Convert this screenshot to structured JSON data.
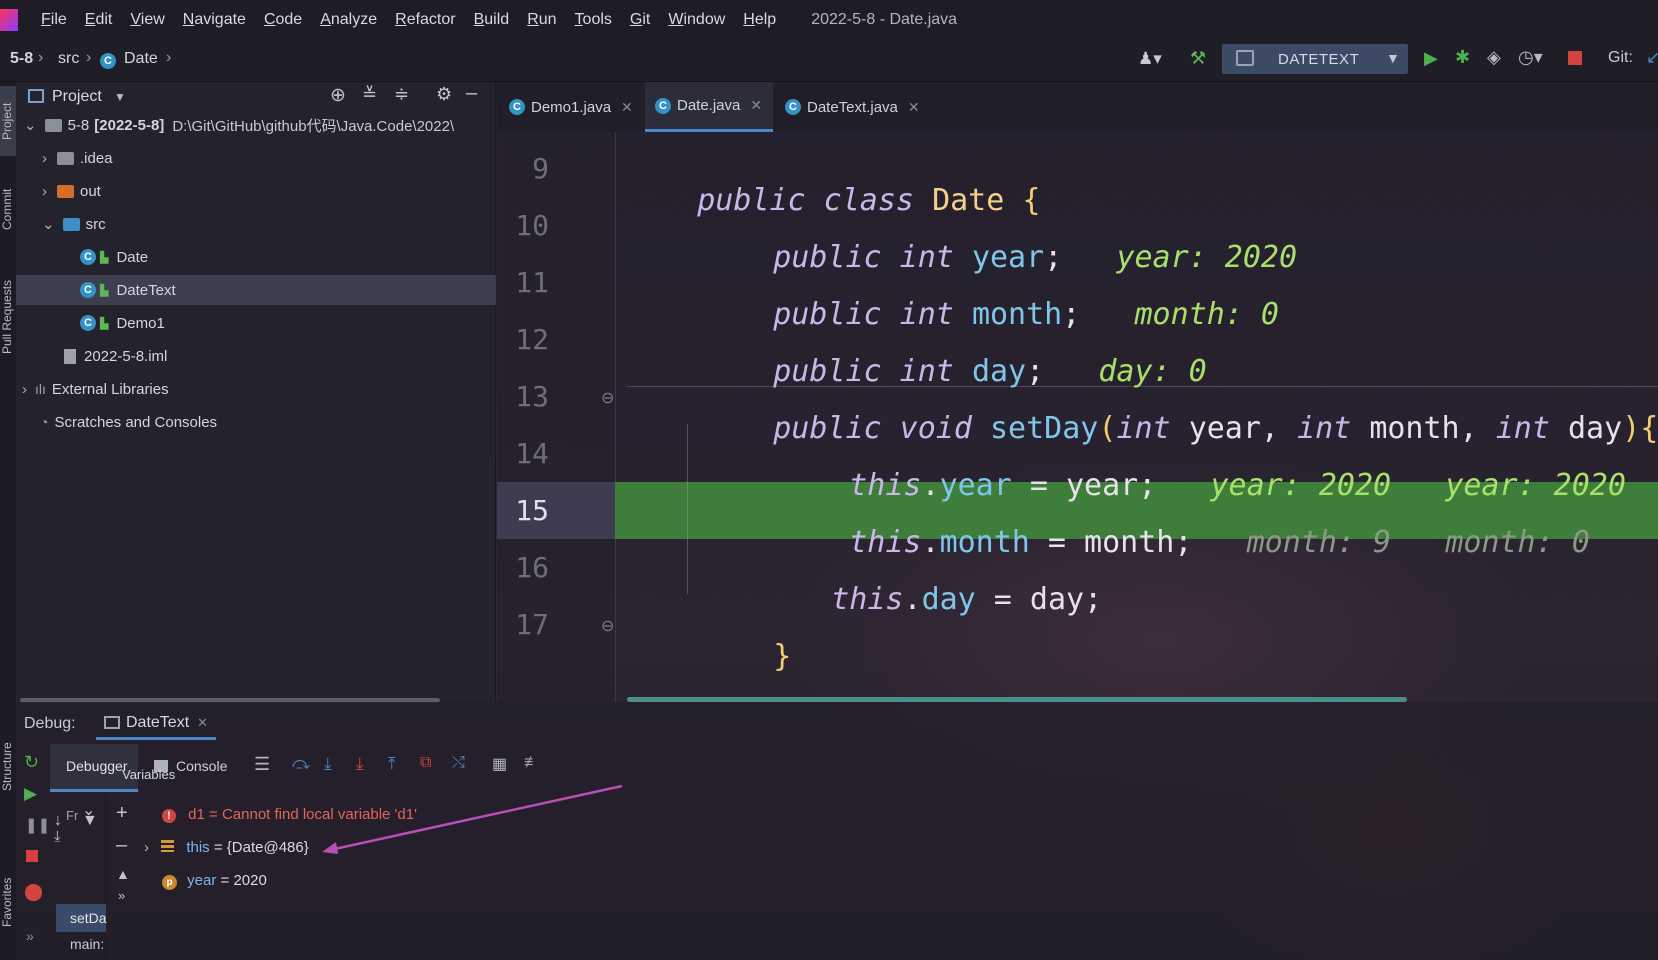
{
  "menubar": {
    "items": [
      "File",
      "Edit",
      "View",
      "Navigate",
      "Code",
      "Analyze",
      "Refactor",
      "Build",
      "Run",
      "Tools",
      "Git",
      "Window",
      "Help"
    ],
    "window_title": "2022-5-8 - Date.java"
  },
  "navbar": {
    "breadcrumbs": [
      "5-8",
      "src",
      "Date"
    ],
    "run_config": "DATETEXT",
    "git_label": "Git:"
  },
  "side_tabs": {
    "project": "Project",
    "commit": "Commit",
    "pull_requests": "Pull Requests",
    "structure": "Structure",
    "favorites": "Favorites"
  },
  "project": {
    "title": "Project",
    "root_name": "5-8",
    "root_bracket": "[2022-5-8]",
    "root_path": "D:\\Git\\GitHub\\github代码\\Java.Code\\2022\\",
    "items": {
      "idea": ".idea",
      "out": "out",
      "src": "src",
      "date": "Date",
      "datetext": "DateText",
      "demo1": "Demo1",
      "iml": "2022-5-8.iml",
      "external": "External Libraries",
      "scratches": "Scratches and Consoles"
    }
  },
  "editor": {
    "tabs": [
      {
        "label": "Demo1.java",
        "active": false
      },
      {
        "label": "Date.java",
        "active": true
      },
      {
        "label": "DateText.java",
        "active": false
      }
    ],
    "line_numbers": [
      "9",
      "10",
      "11",
      "12",
      "13",
      "14",
      "15",
      "16",
      "17"
    ],
    "current_line": "15",
    "code": {
      "l9": {
        "kw": "public class",
        "name": "Date",
        "brace": "{"
      },
      "l10": {
        "kw": "public int",
        "field": "year",
        "semi": ";",
        "hint": "year: 2020"
      },
      "l11": {
        "kw": "public int",
        "field": "month",
        "semi": ";",
        "hint": "month: 0"
      },
      "l12": {
        "kw": "public int",
        "field": "day",
        "semi": ";",
        "hint": "day: 0"
      },
      "l13": {
        "kw": "public void",
        "fn": "setDay",
        "open": "(",
        "p1t": "int",
        "p1": "year,",
        "p2t": "int",
        "p2": "month,",
        "p3t": "int",
        "p3": "day",
        "close": "){"
      },
      "l14": {
        "this": "this",
        "dot": ".",
        "field": "year",
        "rest": " = year;",
        "hint1": "year: 2020",
        "hint2": "year: 2020"
      },
      "l15": {
        "this": "this",
        "dot": ".",
        "field": "month",
        "rest": " = month;",
        "hint1": "month: 9",
        "hint2": "month: 0"
      },
      "l16": {
        "this": "this",
        "dot": ".",
        "field": "day",
        "rest": " = day;"
      },
      "l17": {
        "brace": "}"
      }
    }
  },
  "debug": {
    "label": "Debug:",
    "session_tab": "DateText",
    "tabs": {
      "debugger": "Debugger",
      "console": "Console"
    },
    "frames_label": "Fr",
    "variables_label": "Variables",
    "frames": [
      "setDa",
      "main:"
    ],
    "variables": {
      "d1_name": "d1",
      "d1_value": " = Cannot find local variable 'd1'",
      "this_name": "this",
      "this_value": " = {Date@486}",
      "year_name": "year",
      "year_value": " = 2020"
    }
  },
  "colors": {
    "accent": "#4a88c7",
    "current_line": "#3e7d3a",
    "error": "#e3655d",
    "arrow": "#b84fb7"
  }
}
